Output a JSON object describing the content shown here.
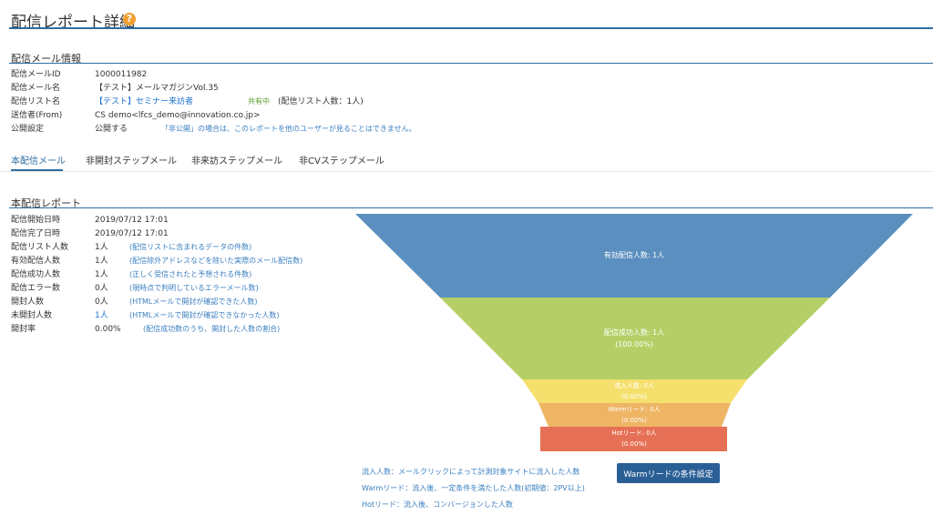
{
  "page": {
    "title": "配信レポート詳細",
    "help": "?"
  },
  "mail_info": {
    "heading": "配信メール情報",
    "rows": [
      {
        "label": "配信メールID",
        "value": "1000011982"
      },
      {
        "label": "配信メール名",
        "value": "【テスト】メールマガジンVol.35"
      },
      {
        "label": "配信リスト名",
        "value": "【テスト】セミナー来訪者",
        "badge": "共有中",
        "note": "(配信リスト人数：1人)"
      },
      {
        "label": "送信者(From)",
        "value": "CS demo<lfcs_demo@innovation.co.jp>"
      },
      {
        "label": "公開設定",
        "value": "公開する",
        "note": "「非公開」の場合は、このレポートを他のユーザーが見ることはできません。"
      }
    ]
  },
  "tabs": [
    {
      "label": "本配信メール",
      "active": true
    },
    {
      "label": "非開封ステップメール"
    },
    {
      "label": "非来訪ステップメール"
    },
    {
      "label": "非CVステップメール"
    }
  ],
  "report": {
    "heading": "本配信レポート",
    "rows": [
      {
        "label": "配信開始日時",
        "value": "2019/07/12 17:01",
        "note": ""
      },
      {
        "label": "配信完了日時",
        "value": "2019/07/12 17:01",
        "note": ""
      },
      {
        "label": "配信リスト人数",
        "value": "1人",
        "note": "(配信リストに含まれるデータの件数)"
      },
      {
        "label": "有効配信人数",
        "value": "1人",
        "note": "(配信除外アドレスなどを除いた実際のメール配信数)"
      },
      {
        "label": "配信成功人数",
        "value": "1人",
        "note": "(正しく受信されたと予想される件数)"
      },
      {
        "label": "配信エラー数",
        "value": "0人",
        "note": "(現時点で判明しているエラーメール数)"
      },
      {
        "label": "開封人数",
        "value": "0人",
        "note": "(HTMLメールで開封が確認できた人数)"
      },
      {
        "label": "未開封人数",
        "value": "1人",
        "note": "(HTMLメールで開封が確認できなかった人数)"
      },
      {
        "label": "開封率",
        "value": "0.00%",
        "note": "(配信成功数のうち、開封した人数の割合)"
      }
    ]
  },
  "funnel": {
    "stages": [
      {
        "label": "有効配信人数: 1人",
        "pct": "",
        "color": "#5b8fbf"
      },
      {
        "label": "配信成功人数: 1人",
        "pct": "(100.00%)",
        "color": "#b5cf66"
      },
      {
        "label": "流入人数: 0人",
        "pct": "(0.00%)",
        "color": "#f5e06e"
      },
      {
        "label": "Warmリード: 0人",
        "pct": "(0.00%)",
        "color": "#eeb565"
      },
      {
        "label": "Hotリード: 0人",
        "pct": "(0.00%)",
        "color": "#e67055"
      }
    ]
  },
  "legend": {
    "inflow": "流入人数：メールクリックによって計測対象サイトに流入した人数",
    "warm": "Warmリード：流入後、一定条件を満たした人数(初期値：2PV以上)",
    "hot": "Hotリード：流入後、コンバージョンした人数"
  },
  "warm_button": {
    "label": "Warmリードの条件設定"
  },
  "colors": {
    "accent": "#2d6da3",
    "link": "#1a73d0",
    "note": "#3a7fc0",
    "button": "#2a5f96"
  }
}
